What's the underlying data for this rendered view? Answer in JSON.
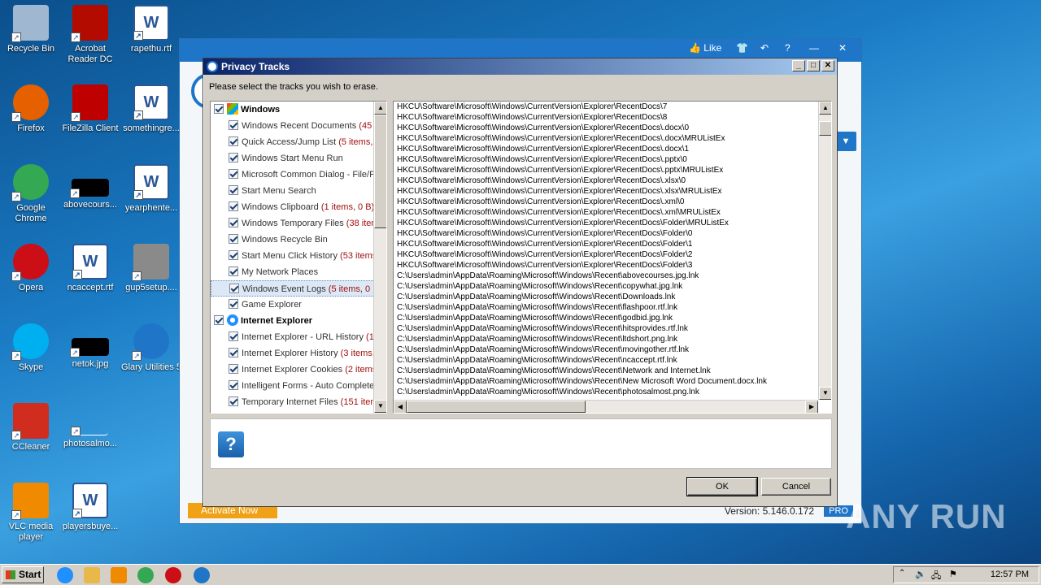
{
  "desktop": {
    "icons": [
      {
        "label": "Recycle Bin",
        "icon": "recycle-bin-icon",
        "color": "#9fb7d0"
      },
      {
        "label": "Acrobat Reader DC",
        "icon": "acrobat-icon",
        "color": "#b30b00"
      },
      {
        "label": "rapethu.rtf",
        "icon": "word-doc-icon",
        "color": "#2b5797"
      },
      {
        "label": "Firefox",
        "icon": "firefox-icon",
        "color": "#e66000"
      },
      {
        "label": "FileZilla Client",
        "icon": "filezilla-icon",
        "color": "#bf0000"
      },
      {
        "label": "somethingre...",
        "icon": "word-doc-icon",
        "color": "#2b5797"
      },
      {
        "label": "Google Chrome",
        "icon": "chrome-icon",
        "color": "#34a853"
      },
      {
        "label": "abovecours...",
        "icon": "black-image-icon",
        "color": "#000000"
      },
      {
        "label": "yearphente...",
        "icon": "word-doc-icon",
        "color": "#2b5797"
      },
      {
        "label": "Opera",
        "icon": "opera-icon",
        "color": "#cc0f16"
      },
      {
        "label": "ncaccept.rtf",
        "icon": "word-doc-icon",
        "color": "#2b5797"
      },
      {
        "label": "gup5setup....",
        "icon": "installer-icon",
        "color": "#8a8a8a"
      },
      {
        "label": "Skype",
        "icon": "skype-icon",
        "color": "#00aff0"
      },
      {
        "label": "netok.jpg",
        "icon": "black-image-icon",
        "color": "#000000"
      },
      {
        "label": "Glary Utilities 5",
        "icon": "glary-icon",
        "color": "#1f76c9"
      },
      {
        "label": "CCleaner",
        "icon": "ccleaner-icon",
        "color": "#d12d1f"
      },
      {
        "label": "photosalmo...",
        "icon": "image-icon",
        "color": "#ffffff"
      },
      {
        "label": "VLC media player",
        "icon": "vlc-icon",
        "color": "#f08a00"
      },
      {
        "label": "playersbuye...",
        "icon": "word-doc-icon",
        "color": "#2b5797"
      }
    ]
  },
  "app": {
    "like_label": "Like",
    "activate_label": "Activate Now",
    "version_label": "Version: 5.146.0.172",
    "pro_label": "PRO"
  },
  "dialog": {
    "title": "Privacy Tracks",
    "prompt": "Please select the tracks you wish to erase.",
    "ok_label": "OK",
    "cancel_label": "Cancel",
    "tree": [
      {
        "type": "group",
        "label": "Windows",
        "count": "",
        "icon": "windows-flag-icon"
      },
      {
        "type": "item",
        "label": "Windows Recent Documents",
        "count": "(45 it"
      },
      {
        "type": "item",
        "label": "Quick Access/Jump List",
        "count": "(5 items, 2"
      },
      {
        "type": "item",
        "label": "Windows Start Menu Run",
        "count": ""
      },
      {
        "type": "item",
        "label": "Microsoft Common Dialog - File/Fo",
        "count": ""
      },
      {
        "type": "item",
        "label": "Start Menu Search",
        "count": ""
      },
      {
        "type": "item",
        "label": "Windows Clipboard",
        "count": "(1 items, 0 B)"
      },
      {
        "type": "item",
        "label": "Windows Temporary Files",
        "count": "(38 item"
      },
      {
        "type": "item",
        "label": "Windows Recycle Bin",
        "count": ""
      },
      {
        "type": "item",
        "label": "Start Menu Click History",
        "count": "(53 items,"
      },
      {
        "type": "item",
        "label": "My Network Places",
        "count": ""
      },
      {
        "type": "item",
        "label": "Windows Event Logs",
        "count": "(5 items, 0 B",
        "selected": true
      },
      {
        "type": "item",
        "label": "Game Explorer",
        "count": ""
      },
      {
        "type": "group",
        "label": "Internet Explorer",
        "count": "",
        "icon": "ie-icon"
      },
      {
        "type": "item",
        "label": "Internet Explorer - URL History",
        "count": "(1:"
      },
      {
        "type": "item",
        "label": "Internet Explorer History",
        "count": "(3 items,"
      },
      {
        "type": "item",
        "label": "Internet Explorer Cookies",
        "count": "(2 items"
      },
      {
        "type": "item",
        "label": "Intelligent Forms - Auto Complete",
        "count": ""
      },
      {
        "type": "item",
        "label": "Temporary Internet Files",
        "count": "(151 item"
      }
    ],
    "paths": [
      "HKCU\\Software\\Microsoft\\Windows\\CurrentVersion\\Explorer\\RecentDocs\\7",
      "HKCU\\Software\\Microsoft\\Windows\\CurrentVersion\\Explorer\\RecentDocs\\8",
      "HKCU\\Software\\Microsoft\\Windows\\CurrentVersion\\Explorer\\RecentDocs\\.docx\\0",
      "HKCU\\Software\\Microsoft\\Windows\\CurrentVersion\\Explorer\\RecentDocs\\.docx\\MRUListEx",
      "HKCU\\Software\\Microsoft\\Windows\\CurrentVersion\\Explorer\\RecentDocs\\.docx\\1",
      "HKCU\\Software\\Microsoft\\Windows\\CurrentVersion\\Explorer\\RecentDocs\\.pptx\\0",
      "HKCU\\Software\\Microsoft\\Windows\\CurrentVersion\\Explorer\\RecentDocs\\.pptx\\MRUListEx",
      "HKCU\\Software\\Microsoft\\Windows\\CurrentVersion\\Explorer\\RecentDocs\\.xlsx\\0",
      "HKCU\\Software\\Microsoft\\Windows\\CurrentVersion\\Explorer\\RecentDocs\\.xlsx\\MRUListEx",
      "HKCU\\Software\\Microsoft\\Windows\\CurrentVersion\\Explorer\\RecentDocs\\.xml\\0",
      "HKCU\\Software\\Microsoft\\Windows\\CurrentVersion\\Explorer\\RecentDocs\\.xml\\MRUListEx",
      "HKCU\\Software\\Microsoft\\Windows\\CurrentVersion\\Explorer\\RecentDocs\\Folder\\MRUListEx",
      "HKCU\\Software\\Microsoft\\Windows\\CurrentVersion\\Explorer\\RecentDocs\\Folder\\0",
      "HKCU\\Software\\Microsoft\\Windows\\CurrentVersion\\Explorer\\RecentDocs\\Folder\\1",
      "HKCU\\Software\\Microsoft\\Windows\\CurrentVersion\\Explorer\\RecentDocs\\Folder\\2",
      "HKCU\\Software\\Microsoft\\Windows\\CurrentVersion\\Explorer\\RecentDocs\\Folder\\3",
      "C:\\Users\\admin\\AppData\\Roaming\\Microsoft\\Windows\\Recent\\abovecourses.jpg.lnk",
      "C:\\Users\\admin\\AppData\\Roaming\\Microsoft\\Windows\\Recent\\copywhat.jpg.lnk",
      "C:\\Users\\admin\\AppData\\Roaming\\Microsoft\\Windows\\Recent\\Downloads.lnk",
      "C:\\Users\\admin\\AppData\\Roaming\\Microsoft\\Windows\\Recent\\flashpoor.rtf.lnk",
      "C:\\Users\\admin\\AppData\\Roaming\\Microsoft\\Windows\\Recent\\godbid.jpg.lnk",
      "C:\\Users\\admin\\AppData\\Roaming\\Microsoft\\Windows\\Recent\\hitsprovides.rtf.lnk",
      "C:\\Users\\admin\\AppData\\Roaming\\Microsoft\\Windows\\Recent\\ltdshort.png.lnk",
      "C:\\Users\\admin\\AppData\\Roaming\\Microsoft\\Windows\\Recent\\movingother.rtf.lnk",
      "C:\\Users\\admin\\AppData\\Roaming\\Microsoft\\Windows\\Recent\\ncaccept.rtf.lnk",
      "C:\\Users\\admin\\AppData\\Roaming\\Microsoft\\Windows\\Recent\\Network and Internet.lnk",
      "C:\\Users\\admin\\AppData\\Roaming\\Microsoft\\Windows\\Recent\\New Microsoft Word Document.docx.lnk",
      "C:\\Users\\admin\\AppData\\Roaming\\Microsoft\\Windows\\Recent\\photosalmost.png.lnk"
    ]
  },
  "watermark": "ANY RUN",
  "taskbar": {
    "start_label": "Start",
    "clock": "12:57 PM",
    "apps": [
      {
        "icon": "ie-icon",
        "color": "#1e90ff"
      },
      {
        "icon": "explorer-icon",
        "color": "#e8b84a"
      },
      {
        "icon": "media-player-icon",
        "color": "#f08a00"
      },
      {
        "icon": "chrome-icon",
        "color": "#34a853"
      },
      {
        "icon": "opera-icon",
        "color": "#cc0f16"
      },
      {
        "icon": "glary-icon",
        "color": "#1f76c9"
      }
    ]
  }
}
